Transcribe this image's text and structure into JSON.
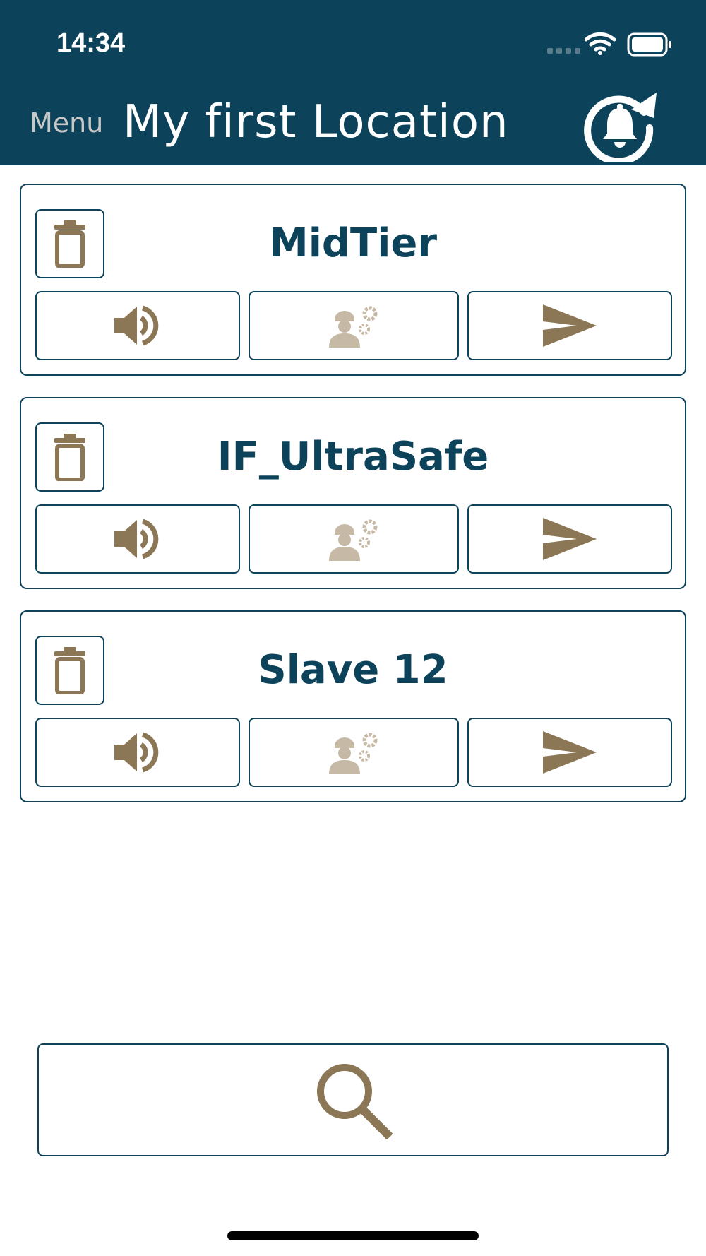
{
  "status_bar": {
    "time": "14:34"
  },
  "header": {
    "menu_label": "Menu",
    "title": "My first Location",
    "refresh_icon": "bell-refresh-icon"
  },
  "devices": [
    {
      "name": "MidTier"
    },
    {
      "name": "IF_UltraSafe"
    },
    {
      "name": "Slave 12"
    }
  ],
  "icons": {
    "delete": "trash-icon",
    "sound": "speaker-icon",
    "service": "technician-gears-icon",
    "send": "send-arrow-icon",
    "search": "search-icon"
  },
  "colors": {
    "primary": "#0c435a",
    "accent": "#8b7755",
    "accent_light": "#c6b9a5",
    "background": "#ffffff"
  }
}
